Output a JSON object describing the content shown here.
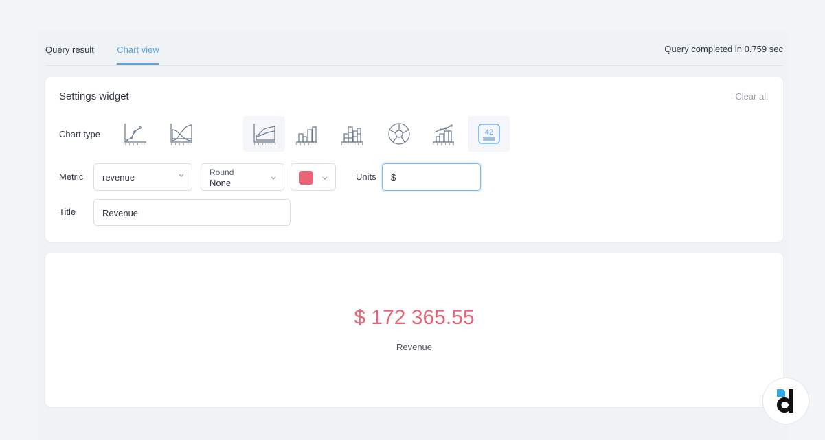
{
  "tabs": [
    {
      "label": "Query result",
      "active": false
    },
    {
      "label": "Chart view",
      "active": true
    }
  ],
  "status": "Query completed in 0.759 sec",
  "settings": {
    "title": "Settings widget",
    "clear_all": "Clear all",
    "chart_type_label": "Chart type",
    "chart_types": [
      {
        "name": "line-chart-icon",
        "selected": false
      },
      {
        "name": "area-overlap-chart-icon",
        "selected": false
      },
      {
        "name": "stacked-area-chart-icon",
        "selected": false,
        "hovered": true
      },
      {
        "name": "bar-chart-icon",
        "selected": false
      },
      {
        "name": "stacked-bar-chart-icon",
        "selected": false
      },
      {
        "name": "pie-chart-icon",
        "selected": false
      },
      {
        "name": "bar-line-combo-chart-icon",
        "selected": false
      },
      {
        "name": "number-kpi-icon",
        "selected": true,
        "text": "42"
      }
    ],
    "metric_label": "Metric",
    "metric_value": "revenue",
    "round_label": "Round",
    "round_value": "None",
    "color_value": "#ea6478",
    "units_label": "Units",
    "units_value": "$",
    "title_label": "Title",
    "title_value": "Revenue"
  },
  "result": {
    "value": "$ 172 365.55",
    "label": "Revenue"
  },
  "colors": {
    "accent": "#5aa3e8",
    "kpi": "#ea6478",
    "icon": "#6b7a8c"
  }
}
